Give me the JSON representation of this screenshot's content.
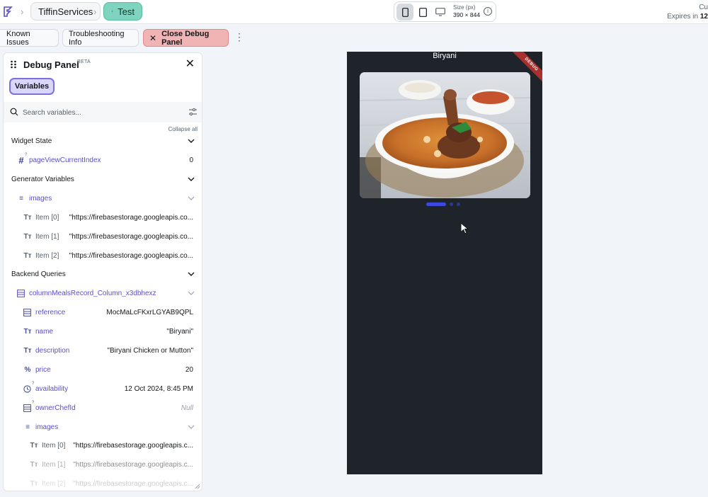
{
  "topbar": {
    "project_name": "TiffinServices",
    "mode_label": "Test",
    "size_label": "Size (px)",
    "size_value": "390 × 844",
    "right_line1": "Cu",
    "right_line2_prefix": "Expires in",
    "right_line2_value": "12"
  },
  "toolbar": {
    "known_issues": "Known Issues",
    "troubleshooting": "Troubleshooting Info",
    "close_debug": "Close Debug Panel"
  },
  "debug_panel": {
    "title": "Debug Panel",
    "beta": "BETA",
    "tab_variables": "Variables",
    "search_placeholder": "Search variables...",
    "collapse_all": "Collapse all",
    "widget_state": {
      "header": "Widget State",
      "items": [
        {
          "name": "pageViewCurrentIndex",
          "value": "0",
          "icon": "hash-icon"
        }
      ]
    },
    "generator_variables": {
      "header": "Generator Variables",
      "list_name": "images",
      "items": [
        {
          "name": "Item [0]",
          "value": "\"https://firebasestorage.googleapis.co..."
        },
        {
          "name": "Item [1]",
          "value": "\"https://firebasestorage.googleapis.co..."
        },
        {
          "name": "Item [2]",
          "value": "\"https://firebasestorage.googleapis.co..."
        }
      ]
    },
    "backend_queries": {
      "header": "Backend Queries",
      "record_name": "columnMealsRecord_Column_x3dbhexz",
      "fields": [
        {
          "name": "reference",
          "value": "MocMaLcFKxrLGYAB9QPL",
          "icon": "doc-ref-icon"
        },
        {
          "name": "name",
          "value": "\"Biryani\"",
          "icon": "text-icon"
        },
        {
          "name": "description",
          "value": "\"Biryani Chicken or Mutton\"",
          "icon": "text-icon"
        },
        {
          "name": "price",
          "value": "20",
          "icon": "percent-icon"
        },
        {
          "name": "availability",
          "value": "12 Oct 2024, 8:45 PM",
          "icon": "clock-icon"
        },
        {
          "name": "ownerChefId",
          "value": "Null",
          "icon": "doc-ref-icon"
        }
      ],
      "images_label": "images",
      "images": [
        {
          "name": "Item [0]",
          "value": "\"https://firebasestorage.googleapis.c..."
        },
        {
          "name": "Item [1]",
          "value": "\"https://firebasestorage.googleapis.c..."
        },
        {
          "name": "Item [2]",
          "value": "\"https://firebasestorage.googleapis.c..."
        }
      ]
    }
  },
  "preview": {
    "title": "Biryani",
    "debug_ribbon": "DEBUG",
    "carousel_active_index": 0,
    "carousel_count": 3
  },
  "colors": {
    "accent_purple": "#5a4fc8",
    "test_green": "#7fd4bf",
    "close_red": "#f1b4b4",
    "preview_bg": "#1e2429"
  }
}
